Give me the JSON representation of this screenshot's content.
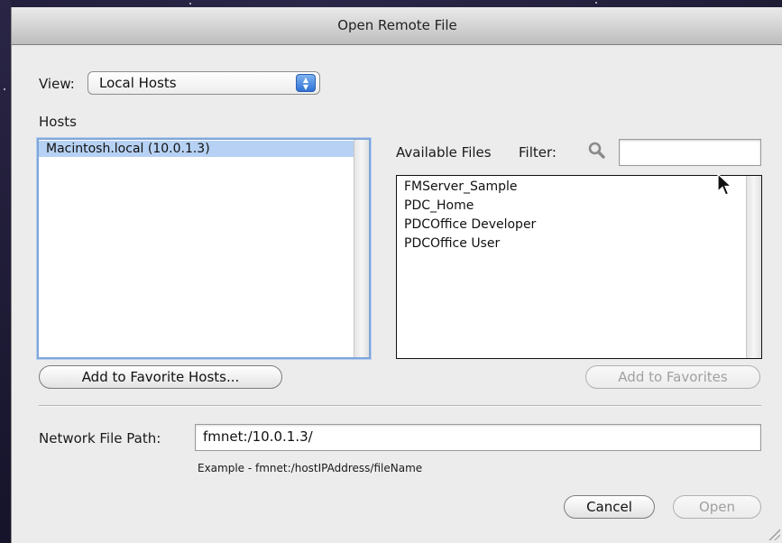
{
  "window": {
    "title": "Open Remote File"
  },
  "view": {
    "label": "View:",
    "selected": "Local Hosts"
  },
  "hosts": {
    "heading": "Hosts",
    "items": [
      "Macintosh.local (10.0.1.3)"
    ],
    "add_favorite_hosts_label": "Add to Favorite Hosts..."
  },
  "files": {
    "heading": "Available Files",
    "filter_label": "Filter:",
    "filter_value": "",
    "items": [
      "FMServer_Sample",
      "PDC_Home",
      "PDCOffice Developer",
      "PDCOffice User"
    ],
    "add_to_favorites_label": "Add to Favorites"
  },
  "network_path": {
    "label": "Network File Path:",
    "value": "fmnet:/10.0.1.3/",
    "example": "Example - fmnet:/hostIPAddress/fileName"
  },
  "buttons": {
    "cancel": "Cancel",
    "open": "Open"
  },
  "icons": {
    "filter": "magnifier-icon",
    "cursor": "arrow-cursor-icon",
    "resize": "resize-grip-icon",
    "popup": "updown-arrows-icon"
  },
  "colors": {
    "selection": "#b6d1f3",
    "focus_ring": "#7fa6d9",
    "popup_accent": "#2f71d6"
  }
}
